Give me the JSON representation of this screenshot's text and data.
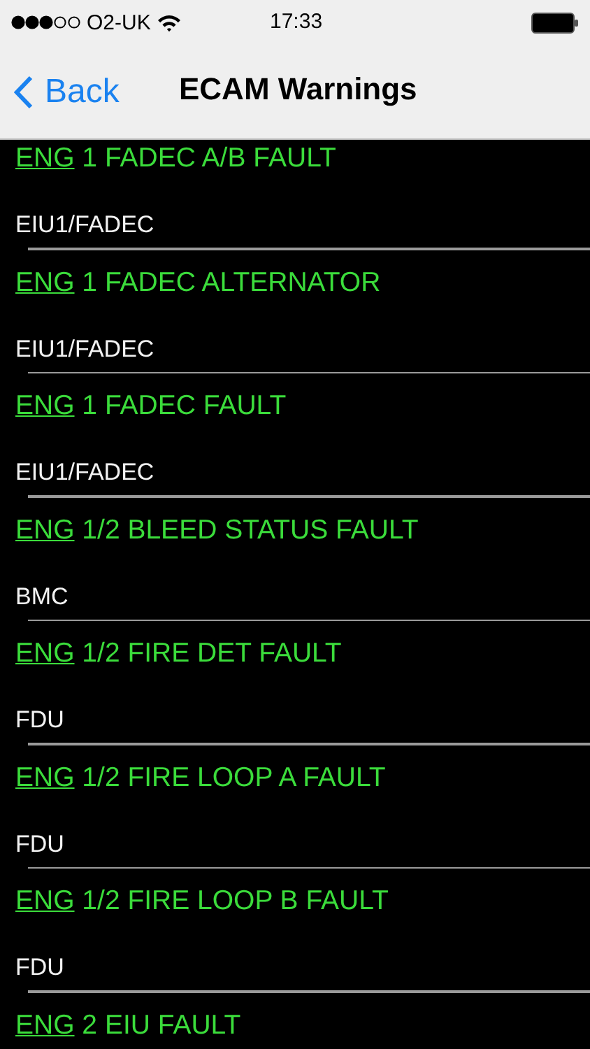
{
  "status_bar": {
    "carrier": "O2-UK",
    "time": "17:33"
  },
  "nav": {
    "back": "Back",
    "title": "ECAM Warnings"
  },
  "warnings": [
    {
      "link": "ENG",
      "text": "1 FADEC A/B FAULT",
      "source": "EIU1/FADEC"
    },
    {
      "link": "ENG",
      "text": "1 FADEC ALTERNATOR",
      "source": "EIU1/FADEC"
    },
    {
      "link": "ENG",
      "text": "1 FADEC FAULT",
      "source": "EIU1/FADEC"
    },
    {
      "link": "ENG",
      "text": "1/2 BLEED STATUS FAULT",
      "source": "BMC"
    },
    {
      "link": "ENG",
      "text": "1/2 FIRE DET FAULT",
      "source": "FDU"
    },
    {
      "link": "ENG",
      "text": "1/2 FIRE LOOP A FAULT",
      "source": "FDU"
    },
    {
      "link": "ENG",
      "text": "1/2 FIRE LOOP B FAULT",
      "source": "FDU"
    },
    {
      "link": "ENG",
      "text": "2 EIU FAULT"
    }
  ]
}
